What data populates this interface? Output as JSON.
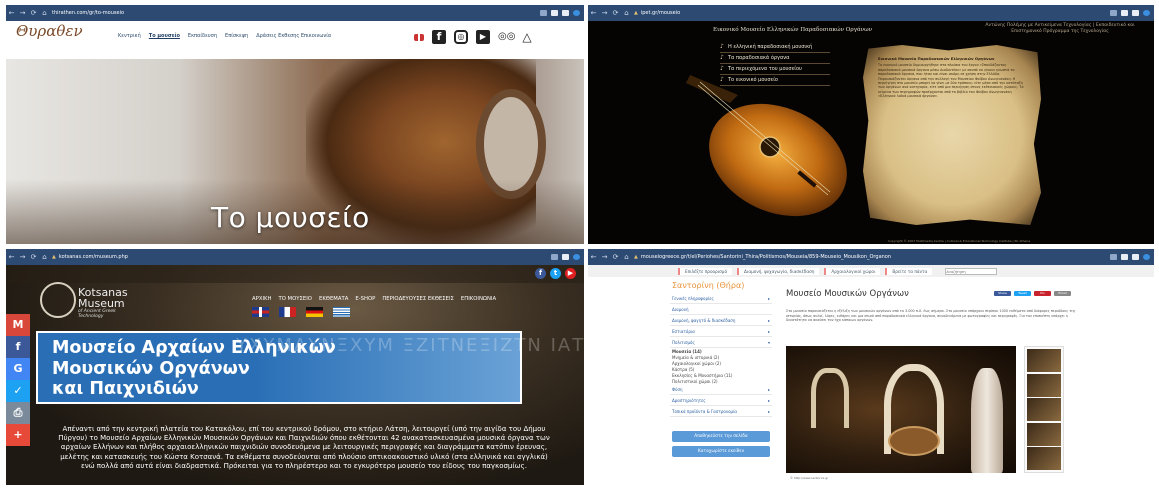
{
  "w1": {
    "url": "thirathen.com/gr/to-mouseio",
    "logo_text": "Θυραθεν",
    "menu": [
      "Κεντρική",
      "Το μουσείο",
      "Εκπαίδευση",
      "Επίσκεψη",
      "Δράσεις Εκθεσης Επικοινωνία"
    ],
    "hero_title": "Το μουσείο"
  },
  "w2": {
    "url": "ipet.gr/mouseio",
    "header": "Εικονικό Μουσείο Ελληνικών Παραδοσιακών Οργάνων",
    "header_right": "Αντώνης Πολέμης με Αντικείμενα Τεχνολογίας | Εκπαιδευτικό και Επιστημονικό Πρόγραμμα της Τεχνολογίας",
    "nav": [
      "Η ελληνική παραδοσιακή μουσική",
      "Τα παραδοσιακά όργανα",
      "Τα περιεχόμενα του μουσείου",
      "Το εικονικό μουσείο"
    ],
    "parchment_title": "Εικονικό Μουσείο Παραδοσιακών Ελληνικών Οργάνων",
    "parchment_text": "Το εικονικό μουσείο δημιουργήθηκε στα πλαίσια του έργου «Σπουδάζοντας παραδοσιακά μουσικά όργανα μέσω Διαδικτύου» με σκοπό να γίνουν γνωστά τα παραδοσιακά όργανα, που ήταν και είναι ακόμη σε χρήση στην Ελλάδα. Παρουσιάζονται όργανα από την συλλογή του Μουσείου Φοίβου Ανωγειανάκη. Η περιήγηση στο μουσείο μπορεί να γίνει με δύο τρόπους: είτε μέσα από την κατάταξη των οργάνων ανά κατηγορία, είτε από μια περιήγηση στους εκθεσιακούς χώρους. Τα κείμενα των περιγραφών προέρχονται από το βιβλίο του Φοίβου Ανωγειανάκη «Ελληνικά λαϊκά μουσικά όργανα».",
    "footer": "Copyright © 2007 Multimedia Centre | Cultural & Educational Technology Institute | RC Athena"
  },
  "w3": {
    "url": "kotsanas.com/museum.php",
    "logo_name_1": "Kotsanas",
    "logo_name_2": "Museum",
    "logo_sub_1": "of Ancient Greek",
    "logo_sub_2": "Technology",
    "menu": [
      "ΑΡΧΙΚΗ",
      "ΤΟ ΜΟΥΣΕΙΟ",
      "ΕΚΘΕΜΑΤΑ",
      "E-SHOP",
      "ΠΕΡΙΟΔΕΥΟΥΣΕΣ ΕΚΘΕΣΕΙΣ",
      "ΕΠΙΚΟΙΝΩΝΙΑ"
    ],
    "banner_greek": "ΥΧΥΜΔΥΝΞΧΥΜ ΞΖΙΤΝΕΞΙΖΤΝ ΙΑΤΕΡΤΜΙΑΤΕΡ",
    "banner_title_1": "Μουσείο Αρχαίων Ελληνικών",
    "banner_title_2": "Μουσικών Οργάνων",
    "banner_title_3": "και Παιχνιδιών",
    "paragraph": "Απέναντι από την κεντρική πλατεία του Κατακόλου, επί του κεντρικού δρόμου, στο κτήριο Λάτση, λειτουργεί (υπό την αιγίδα του Δήμου Πύργου) το Μουσείο Αρχαίων Ελληνικών Μουσικών Οργάνων και Παιχνιδιών όπου εκθέτονται 42 ανακατασκευασμένα μουσικά όργανα των αρχαίων Ελλήνων και πλήθος αρχαιοελληνικών παιχνιδιών συνοδευόμενα με λειτουργικές περιγραφές και διαγράμματα κατόπιν έρευνας, μελέτης και κατασκευής του Κώστα Κοτσανά. Τα εκθέματα συνοδεύονται από πλούσιο οπτικοακουστικό υλικό (στα ελληνικά και αγγλικά) ενώ πολλά από αυτά είναι διαδραστικά. Πρόκειται για το πληρέστερο και το εγκυρότερο μουσείο του είδους του παγκοσμίως."
  },
  "w4": {
    "url": "mouseiogreece.gr/t/el/Periohes/Santorini_Thira/Politismos/Mouseia/859-Mouseio_Mousikon_Organon",
    "tabs": [
      "Επιλέξτε προορισμό",
      "Διαμονή, ψυχαγωγία, διασκέδαση",
      "Αρχαιολογικοί χώροι",
      "Βρείτε τα πάντα"
    ],
    "search_placeholder": "Αναζήτηση",
    "sidebar_title": "Σαντορίνη (Θήρα)",
    "sidebar_items": [
      "Γενικές πληροφορίες",
      "Διαμονή",
      "Διαμονή, φαγητό & διασκέδαση",
      "Εστιατόρια",
      "Πολιτισμός"
    ],
    "sidebar_sub": [
      "Μουσεία (14)",
      "Μνημεία & ιστορικά (2)",
      "Αρχαιολογικοί χώροι (2)",
      "Κάστρα (5)",
      "Εκκλησίες & Μοναστήρια (11)",
      "Πολιτιστικοί χώροι (2)"
    ],
    "sidebar_items_2": [
      "Φύση",
      "Δραστηριότητες",
      "Τοπικά προϊόντα & Γαστρονομία"
    ],
    "btn_1": "Αποθηκεύστε την σελίδα",
    "btn_2": "Καταχωρίστε εκείθεν",
    "main_title": "Μουσείο Μουσικών Οργάνων",
    "share": [
      "Share",
      "Tweet",
      "Pin",
      "Email"
    ],
    "main_text": "Στο μουσείο παρουσιάζεται η εξέλιξη των μουσικών οργάνων από το 3.000 π.Χ. έως σήμερα. Στο μουσείο υπάρχουν περίπου 1000 εκθέματα από διάφορες περιόδους της ιστορίας, όπως αυλοί, λύρες, κιθάρες και μια σειρά από παραδοσιακά ελληνικά όργανα, συνοδευόμενα με φωτογραφίες και περιγραφές. Για τον επισκέπτη υπάρχει η δυνατότητα να ακούσει τον ήχο κάποιων οργάνων.",
    "caption": "© http://www.santorini.gr"
  },
  "colors": {
    "chrome": "#2c4a72",
    "kotsanas_blue": "#2a6fb6",
    "orange": "#e7933a"
  }
}
